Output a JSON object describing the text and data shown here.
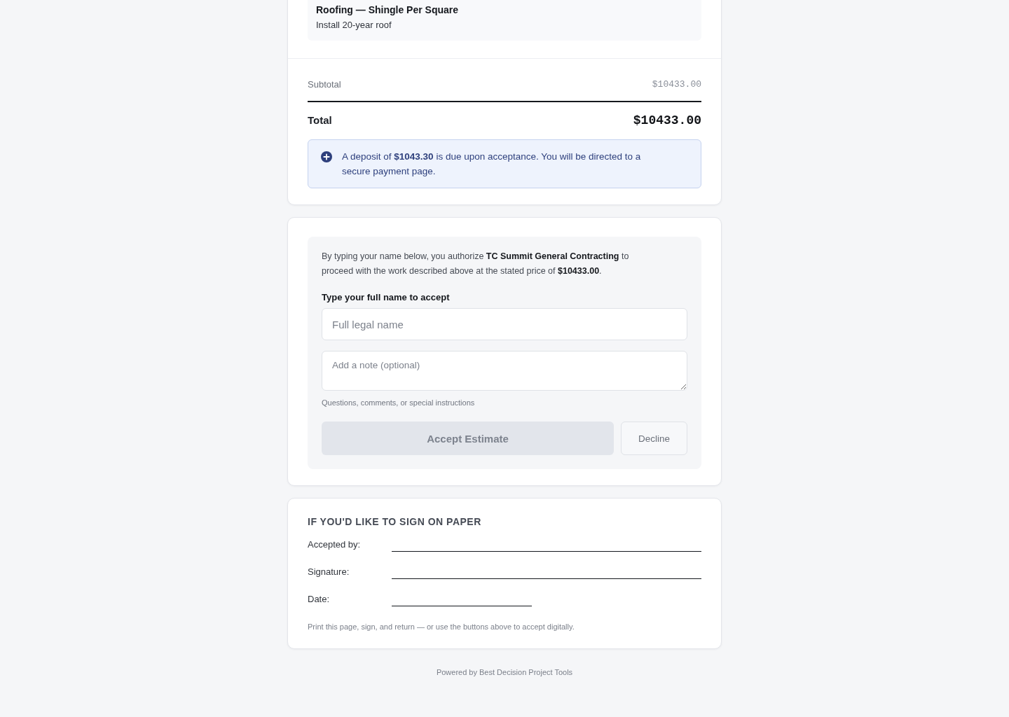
{
  "line_item": {
    "title": "Roofing — Shingle Per Square",
    "description": "Install 20-year roof"
  },
  "totals": {
    "subtotal_label": "Subtotal",
    "subtotal_value": "$10433.00",
    "total_label": "Total",
    "total_value": "$10433.00"
  },
  "deposit_notice": "A deposit of **$1043.30** is due upon acceptance. You will be directed to a secure payment page.",
  "acceptance": {
    "agreement": "By typing your name below, you authorize **TC Summit General Contracting** to proceed with the work described above at the stated price of **$10433.00**.",
    "name_label": "Type your full name to accept",
    "name_field": {
      "placeholder": "Full legal name"
    },
    "note_field": {
      "placeholder": "Add a note (optional)"
    },
    "note_hint": "Questions, comments, or special instructions",
    "accept_button": {
      "label": "Accept Estimate",
      "disabled": true
    },
    "decline_button": {
      "label": "Decline"
    }
  },
  "paper_signing": {
    "heading": "IF YOU'D LIKE TO SIGN ON PAPER",
    "lines": [
      {
        "label": "Accepted by:",
        "kind": "full"
      },
      {
        "label": "Signature:",
        "kind": "full"
      },
      {
        "label": "Date:",
        "kind": "short"
      }
    ],
    "note": "Print this page, sign, and return — or use the buttons above to accept digitally."
  },
  "footer": "Powered by Best Decision Project Tools"
}
